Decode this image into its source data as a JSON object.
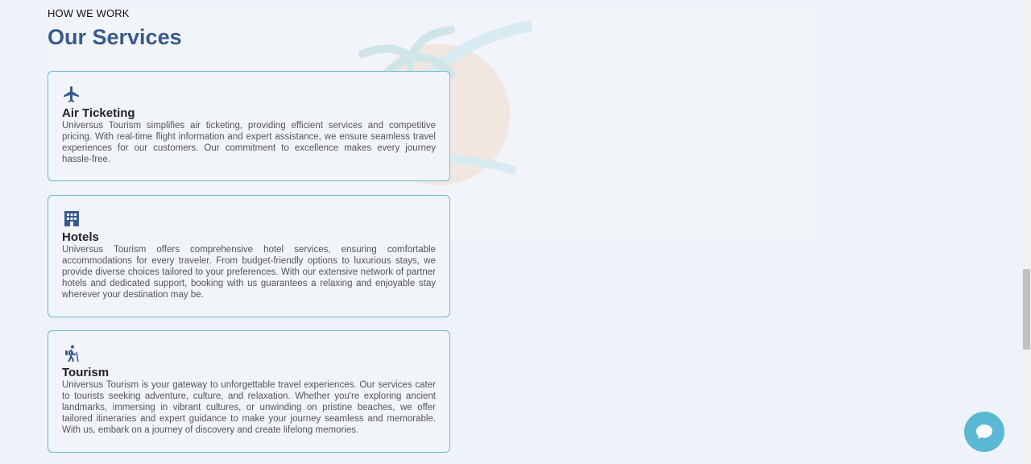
{
  "section": {
    "eyebrow": "HOW WE WORK",
    "title": "Our Services"
  },
  "services": [
    {
      "icon": "plane-icon",
      "title": "Air Ticketing",
      "description": "Universus Tourism simplifies air ticketing, providing efficient services and competitive pricing. With real-time flight information and expert assistance, we ensure seamless travel experiences for our customers. Our commitment to excellence makes every journey hassle-free."
    },
    {
      "icon": "hotel-icon",
      "title": "Hotels",
      "description": "Universus Tourism offers comprehensive hotel services, ensuring comfortable accommodations for every traveler. From budget-friendly options to luxurious stays, we provide diverse choices tailored to your preferences. With our extensive network of partner hotels and dedicated support, booking with us guarantees a relaxing and enjoyable stay wherever your destination may be."
    },
    {
      "icon": "hiker-icon",
      "title": "Tourism",
      "description": "Universus Tourism is your gateway to unforgettable travel experiences. Our services cater to tourists seeking adventure, culture, and relaxation. Whether you're exploring ancient landmarks, immersing in vibrant cultures, or unwinding on pristine beaches, we offer tailored itineraries and expert guidance to make your journey seamless and memorable. With us, embark on a journey of discovery and create lifelong memories."
    }
  ],
  "chat": {
    "icon": "chat-bubble-icon"
  },
  "colors": {
    "accent": "#3a5a8c",
    "card_border": "#6cb9d1",
    "chat_button": "#5bb8d4",
    "background": "#eef2f9"
  }
}
